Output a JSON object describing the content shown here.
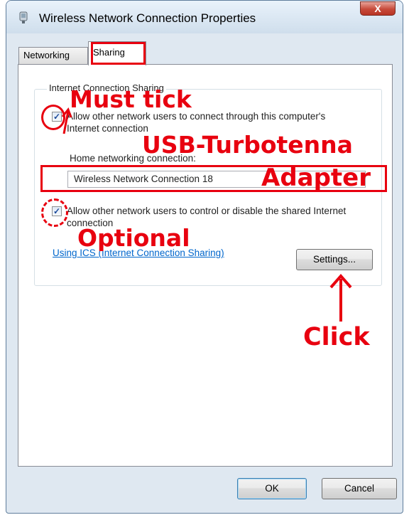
{
  "window": {
    "title": "Wireless Network Connection Properties",
    "close_label": "X"
  },
  "tabs": [
    {
      "label": "Networking",
      "selected": false
    },
    {
      "label": "Sharing",
      "selected": true
    }
  ],
  "ics": {
    "group_label": "Internet Connection Sharing",
    "allow_connect_label": "Allow other network users to connect through this computer's Internet connection",
    "allow_connect_checked": true,
    "home_networking_label": "Home networking connection:",
    "home_networking_value": "Wireless Network Connection 18",
    "allow_control_label": "Allow other network users to control or disable the shared Internet connection",
    "allow_control_checked": true,
    "link_text": "Using ICS (Internet Connection Sharing)",
    "settings_button": "Settings..."
  },
  "footer": {
    "ok_label": "OK",
    "cancel_label": "Cancel"
  },
  "annotations": {
    "must_tick": "Must tick",
    "usb_turbotenna": "USB-Turbotenna",
    "adapter": "Adapter",
    "optional": "Optional",
    "click": "Click",
    "color": "#e8000f"
  },
  "colors": {
    "window_frame": "#dfe8f1",
    "link": "#0066cc"
  }
}
